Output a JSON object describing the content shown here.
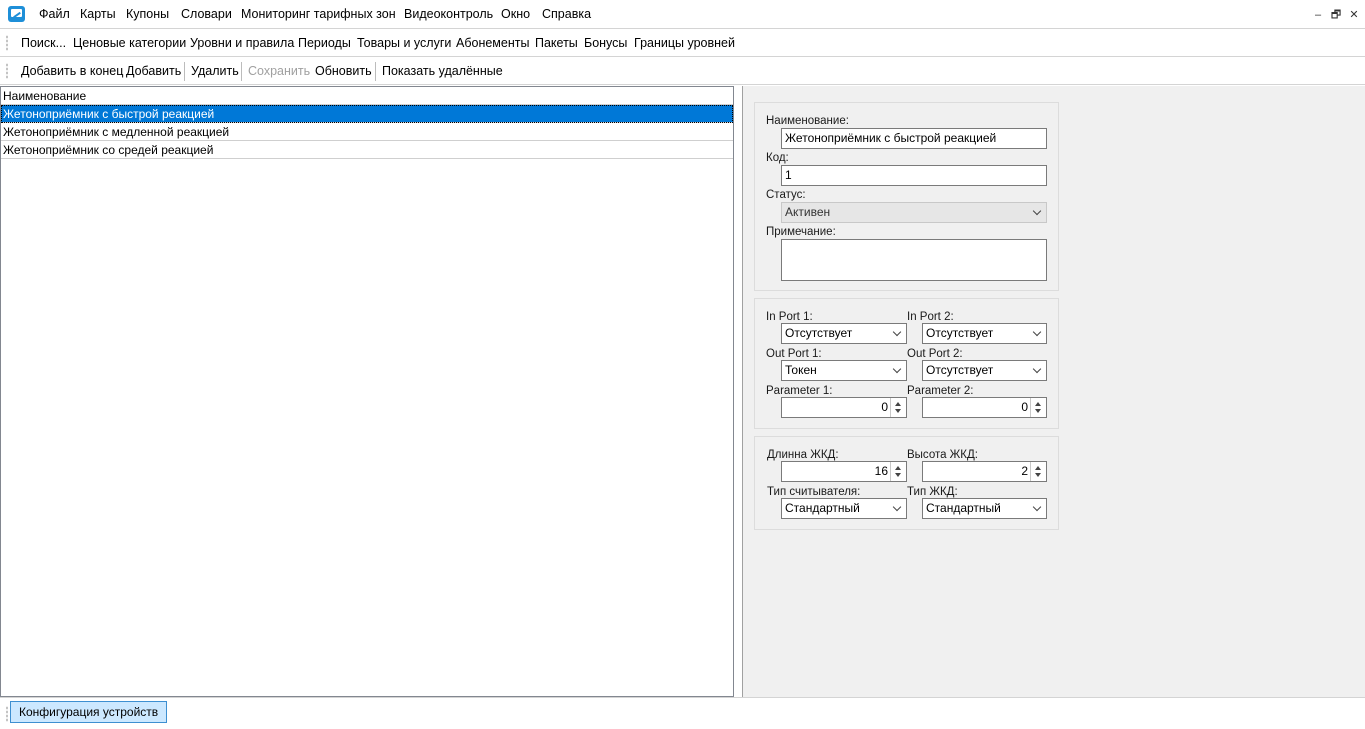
{
  "menu": {
    "items": [
      "Файл",
      "Карты",
      "Купоны",
      "Словари",
      "Мониторинг тарифных зон",
      "Видеоконтроль",
      "Окно",
      "Справка"
    ]
  },
  "window_controls": {
    "minimize": "–",
    "restore": "🗗",
    "close": "✕"
  },
  "nav": {
    "items": [
      "Поиск...",
      "Ценовые категории",
      "Уровни и правила",
      "Периоды",
      "Товары и услуги",
      "Абонементы",
      "Пакеты",
      "Бонусы",
      "Границы уровней"
    ]
  },
  "toolbar": {
    "add_end": "Добавить в конец",
    "add": "Добавить",
    "delete": "Удалить",
    "save": "Сохранить",
    "refresh": "Обновить",
    "show_deleted": "Показать удалённые"
  },
  "list": {
    "header": "Наименование",
    "rows": [
      "Жетоноприёмник с быстрой реакцией",
      "Жетоноприёмник с медленной реакцией",
      "Жетоноприёмник со средей реакцией"
    ],
    "selected_index": 0
  },
  "form": {
    "name_label": "Наименование:",
    "name_value": "Жетоноприёмник с быстрой реакцией",
    "code_label": "Код:",
    "code_value": "1",
    "status_label": "Статус:",
    "status_value": "Активен",
    "note_label": "Примечание:",
    "note_value": "",
    "in_port1_label": "In Port 1:",
    "in_port1_value": "Отсутствует",
    "in_port2_label": "In Port 2:",
    "in_port2_value": "Отсутствует",
    "out_port1_label": "Out Port 1:",
    "out_port1_value": "Токен",
    "out_port2_label": "Out Port 2:",
    "out_port2_value": "Отсутствует",
    "param1_label": "Parameter 1:",
    "param1_value": "0",
    "param2_label": "Parameter 2:",
    "param2_value": "0",
    "lcd_len_label": "Длинна ЖКД:",
    "lcd_len_value": "16",
    "lcd_height_label": "Высота ЖКД:",
    "lcd_height_value": "2",
    "reader_type_label": "Тип считывателя:",
    "reader_type_value": "Стандартный",
    "lcd_type_label": "Тип ЖКД:",
    "lcd_type_value": "Стандартный"
  },
  "status": {
    "task_button": "Конфигурация устройств"
  }
}
